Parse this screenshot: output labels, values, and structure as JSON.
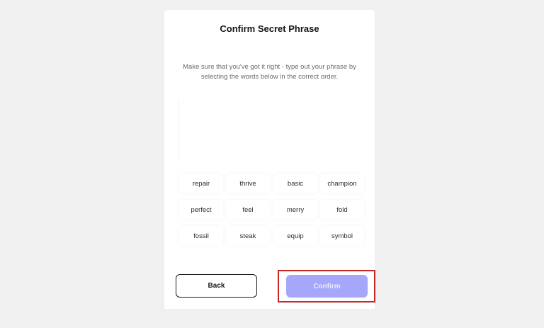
{
  "dialog": {
    "title": "Confirm Secret Phrase",
    "instructions": "Make sure that you've got it right - type out your phrase by selecting the words below in the correct order."
  },
  "words": [
    "repair",
    "thrive",
    "basic",
    "champion",
    "perfect",
    "feel",
    "merry",
    "fold",
    "fossil",
    "steak",
    "equip",
    "symbol"
  ],
  "buttons": {
    "back_label": "Back",
    "confirm_label": "Confirm"
  },
  "colors": {
    "confirm_button": "#a6a6fb",
    "highlight_border": "#c62828",
    "background": "#eff0ef"
  }
}
